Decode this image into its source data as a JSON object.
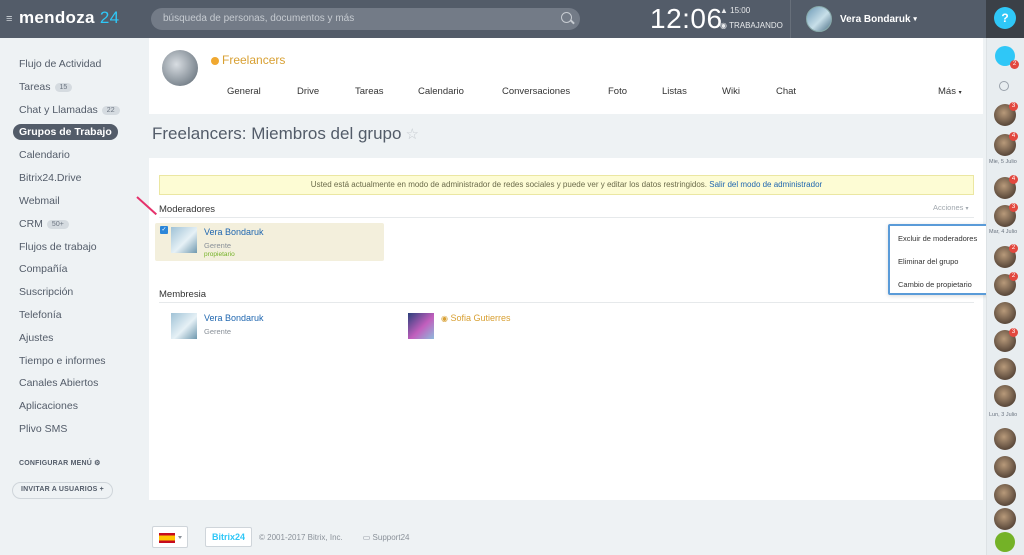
{
  "topbar": {
    "logo_name": "mendoza",
    "logo_num": "24",
    "search_placeholder": "búsqueda de personas, documentos y más",
    "clock": "12:06",
    "alarm_time": "15:00",
    "work_status": "TRABAJANDO",
    "user_name": "Vera Bondaruk",
    "help_label": "?"
  },
  "nav": {
    "items": [
      {
        "label": "Flujo de Actividad"
      },
      {
        "label": "Tareas",
        "badge": "15"
      },
      {
        "label": "Chat y Llamadas",
        "badge": "22"
      },
      {
        "label": "Grupos de Trabajo"
      },
      {
        "label": "Calendario"
      },
      {
        "label": "Bitrix24.Drive"
      },
      {
        "label": "Webmail"
      },
      {
        "label": "CRM",
        "badge": "50+"
      },
      {
        "label": "Flujos de trabajo"
      },
      {
        "label": "Compañía"
      },
      {
        "label": "Suscripción"
      },
      {
        "label": "Telefonía"
      },
      {
        "label": "Ajustes"
      },
      {
        "label": "Tiempo e informes"
      },
      {
        "label": "Canales Abiertos"
      },
      {
        "label": "Aplicaciones"
      },
      {
        "label": "Plivo SMS"
      }
    ],
    "configure": "CONFIGURAR MENÚ",
    "invite": "INVITAR A USUARIOS"
  },
  "group": {
    "name": "Freelancers",
    "tabs": [
      "General",
      "Drive",
      "Tareas",
      "Calendario",
      "Conversaciones",
      "Foto",
      "Listas",
      "Wiki",
      "Chat",
      "Más"
    ]
  },
  "page": {
    "title": "Freelancers: Miembros del grupo",
    "notice_text": "Usted está actualmente en modo de administrador de redes sociales y puede ver y editar los datos restringidos.",
    "notice_link": "Salir del modo de administrador",
    "moderators_title": "Moderadores",
    "members_title": "Membresia",
    "actions_label": "Acciones",
    "moderator": {
      "name": "Vera Bondaruk",
      "role": "Gerente",
      "owner": "propietario"
    },
    "members": [
      {
        "name": "Vera Bondaruk",
        "role": "Gerente"
      },
      {
        "name": "Sofia Gutierres",
        "role": ""
      }
    ]
  },
  "dropdown": {
    "items": [
      "Excluir de moderadores",
      "Eliminar del grupo",
      "Cambio de propietario"
    ]
  },
  "footer": {
    "brand": "Bitrix24",
    "copyright": "© 2001-2017 Bitrix, Inc.",
    "support": "Support24"
  },
  "rightbar": {
    "dates": [
      "Mie, 5 Julio",
      "Mar, 4 Julio",
      "Lun, 3 Julio"
    ],
    "counters": [
      "3",
      "4",
      "4",
      "3",
      "2",
      "2",
      "3"
    ]
  },
  "colors": {
    "topbar": "#535c69",
    "accent": "#2fc7f7",
    "link": "#2067b0",
    "group_orange": "#d8a033"
  }
}
